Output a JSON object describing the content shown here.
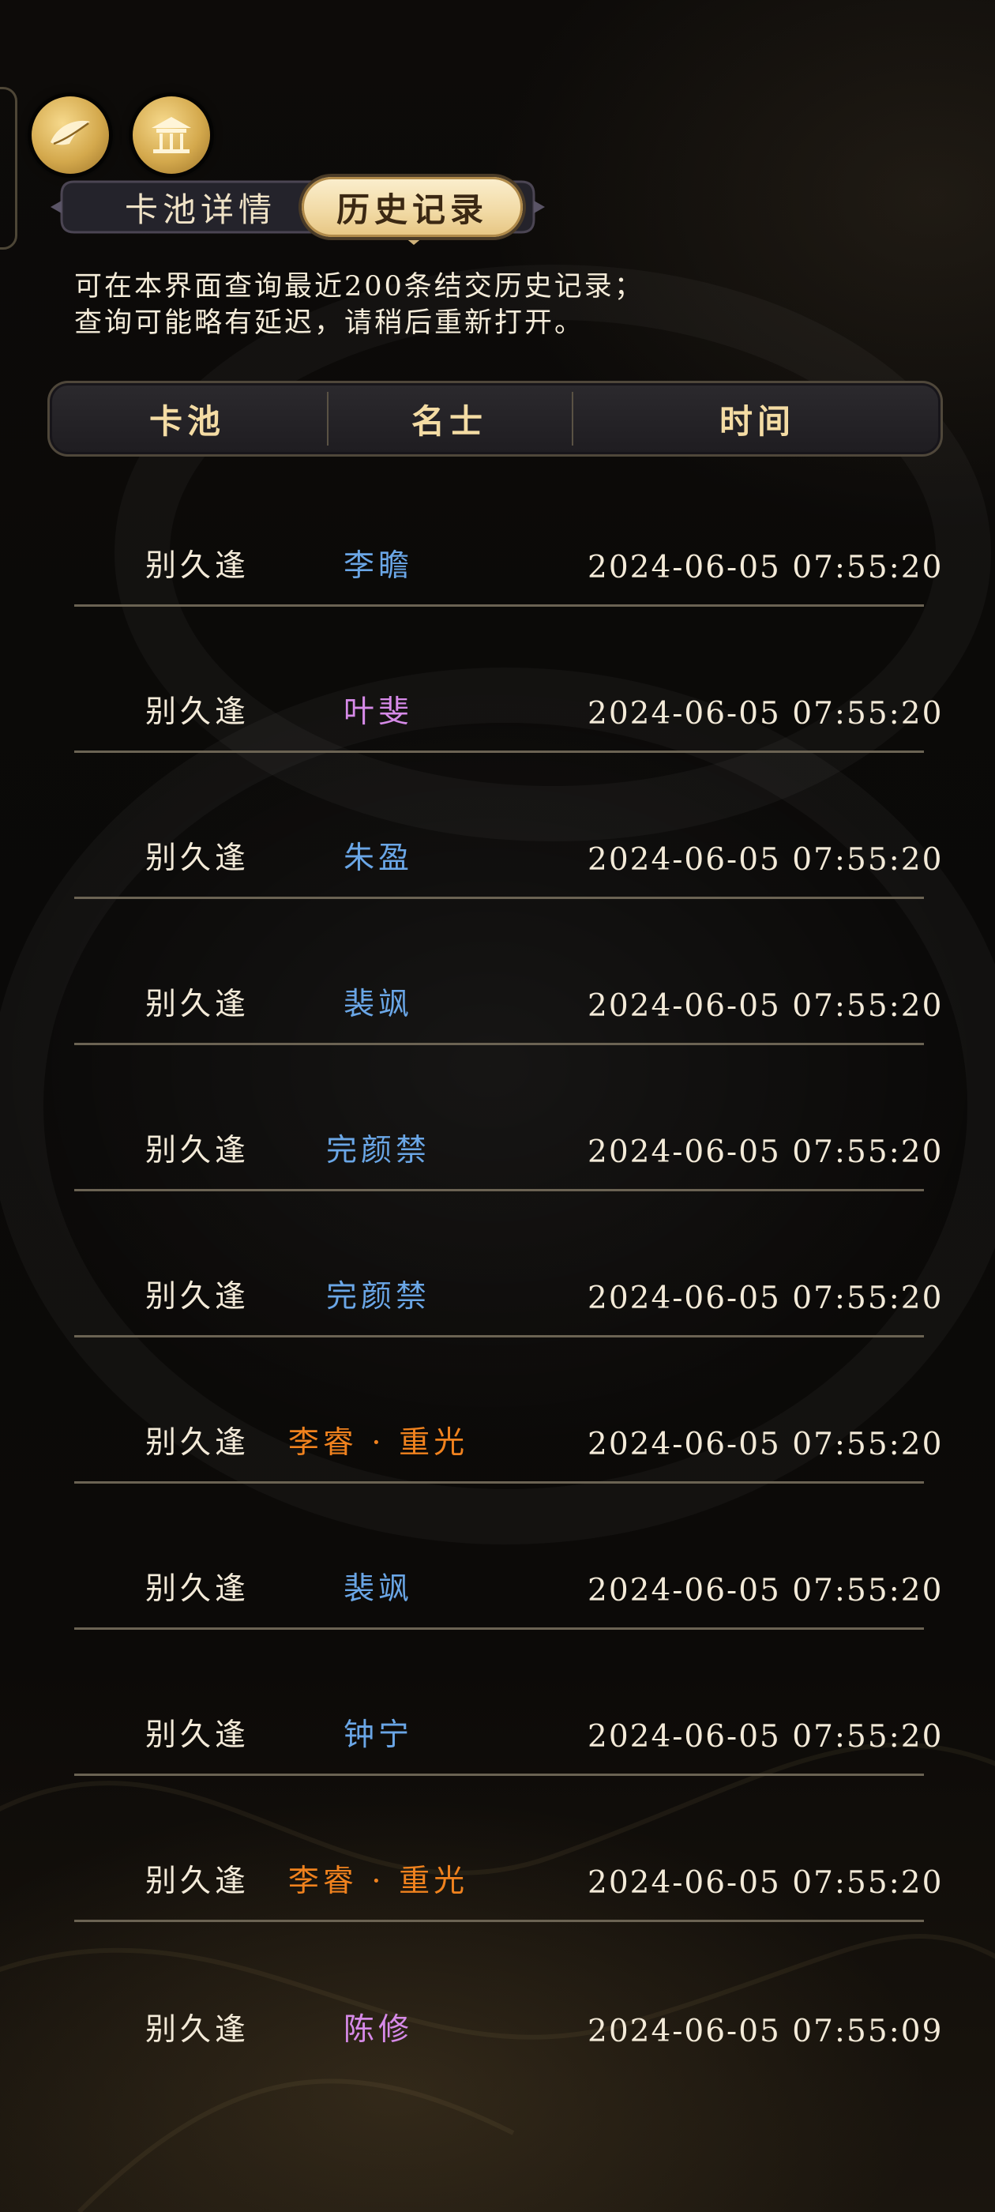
{
  "colors": {
    "blue": "#6aa6e6",
    "purple": "#d68ae8",
    "orange": "#f0821e",
    "gold_header": "#f4dca4"
  },
  "top_icons": [
    {
      "name": "feather-cloud-icon"
    },
    {
      "name": "pavilion-icon"
    }
  ],
  "tabs": {
    "detail": "卡池详情",
    "history": "历史记录",
    "active": "history"
  },
  "notice": {
    "line1": "可在本界面查询最近200条结交历史记录；",
    "line2": "查询可能略有延迟，请稍后重新打开。"
  },
  "table": {
    "headers": {
      "pool": "卡池",
      "hero": "名士",
      "time": "时间"
    },
    "rows": [
      {
        "pool": "别久逢",
        "hero": "李瞻",
        "time": "2024-06-05 07:55:20",
        "color": "blue"
      },
      {
        "pool": "别久逢",
        "hero": "叶斐",
        "time": "2024-06-05 07:55:20",
        "color": "purple"
      },
      {
        "pool": "别久逢",
        "hero": "朱盈",
        "time": "2024-06-05 07:55:20",
        "color": "blue"
      },
      {
        "pool": "别久逢",
        "hero": "裴飒",
        "time": "2024-06-05 07:55:20",
        "color": "blue"
      },
      {
        "pool": "别久逢",
        "hero": "完颜禁",
        "time": "2024-06-05 07:55:20",
        "color": "blue"
      },
      {
        "pool": "别久逢",
        "hero": "完颜禁",
        "time": "2024-06-05 07:55:20",
        "color": "blue"
      },
      {
        "pool": "别久逢",
        "hero": "李睿 · 重光",
        "time": "2024-06-05 07:55:20",
        "color": "orange"
      },
      {
        "pool": "别久逢",
        "hero": "裴飒",
        "time": "2024-06-05 07:55:20",
        "color": "blue"
      },
      {
        "pool": "别久逢",
        "hero": "钟宁",
        "time": "2024-06-05 07:55:20",
        "color": "blue"
      },
      {
        "pool": "别久逢",
        "hero": "李睿 · 重光",
        "time": "2024-06-05 07:55:20",
        "color": "orange"
      },
      {
        "pool": "别久逢",
        "hero": "陈修",
        "time": "2024-06-05 07:55:09",
        "color": "purple"
      }
    ]
  }
}
